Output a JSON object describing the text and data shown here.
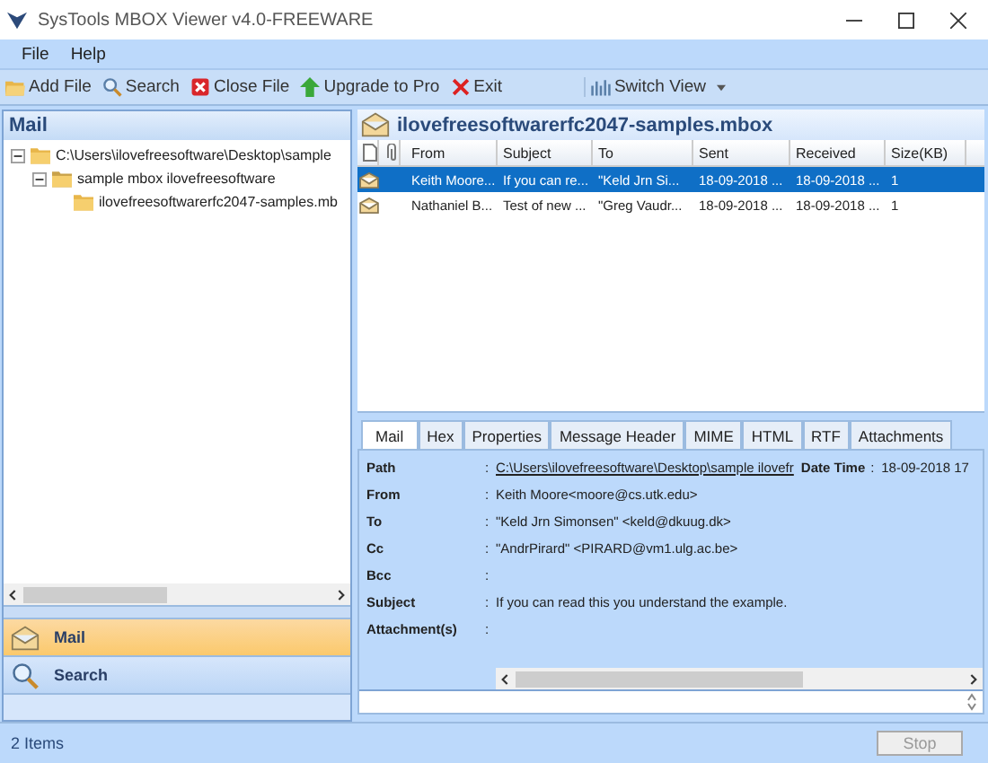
{
  "window": {
    "title": "SysTools MBOX Viewer v4.0-FREEWARE"
  },
  "menu": [
    "File",
    "Help"
  ],
  "toolbar": [
    {
      "kind": "add",
      "label": "Add File"
    },
    {
      "kind": "search",
      "label": "Search"
    },
    {
      "kind": "close",
      "label": "Close File"
    },
    {
      "kind": "upgrade",
      "label": "Upgrade to Pro"
    },
    {
      "kind": "exit",
      "label": "Exit"
    },
    {
      "kind": "switch",
      "label": "Switch View"
    }
  ],
  "sidebar": {
    "title": "Mail",
    "tree": [
      {
        "label": "C:\\Users\\ilovefreesoftware\\Desktop\\sample",
        "expanded": true,
        "children": [
          {
            "label": "sample mbox ilovefreesoftware",
            "expanded": true,
            "children": [
              {
                "label": "ilovefreesoftwarerfc2047-samples.mb"
              }
            ]
          }
        ]
      }
    ],
    "nav": [
      {
        "kind": "mail",
        "label": "Mail",
        "selected": true
      },
      {
        "kind": "search",
        "label": "Search",
        "selected": false
      }
    ]
  },
  "mailbox": {
    "title": "ilovefreesoftwarerfc2047-samples.mbox",
    "columns": [
      "From",
      "Subject",
      "To",
      "Sent",
      "Received",
      "Size(KB)"
    ],
    "rows": [
      {
        "selected": true,
        "cells": [
          "Keith Moore...",
          "If you can re...",
          "\"Keld Jrn Si...",
          "18-09-2018 ...",
          "18-09-2018 ...",
          "1"
        ]
      },
      {
        "selected": false,
        "cells": [
          "Nathaniel B...",
          "Test of new ...",
          "\"Greg Vaudr...",
          "18-09-2018 ...",
          "18-09-2018 ...",
          "1"
        ]
      }
    ]
  },
  "tabs": [
    {
      "label": "Mail",
      "selected": true
    },
    {
      "label": "Hex",
      "selected": false
    },
    {
      "label": "Properties",
      "selected": false
    },
    {
      "label": "Message Header",
      "selected": false
    },
    {
      "label": "MIME",
      "selected": false
    },
    {
      "label": "HTML",
      "selected": false
    },
    {
      "label": "RTF",
      "selected": false
    },
    {
      "label": "Attachments",
      "selected": false
    }
  ],
  "details": {
    "fields": [
      {
        "label": "Path",
        "value": "C:\\Users\\ilovefreesoftware\\Desktop\\sample ilovefr",
        "link": true
      },
      {
        "label": "From",
        "value": "Keith Moore<moore@cs.utk.edu>",
        "link": false
      },
      {
        "label": "To",
        "value": "\"Keld Jrn Simonsen\" <keld@dkuug.dk>",
        "link": false
      },
      {
        "label": "Cc",
        "value": "\"AndrPirard\" <PIRARD@vm1.ulg.ac.be>",
        "link": false
      },
      {
        "label": "Bcc"
      },
      {
        "label": "Subject",
        "value": "If you can read this you understand the example.",
        "link": false
      },
      {
        "label": "Attachment(s)"
      }
    ],
    "separator": ":",
    "date_time": {
      "label": "Date Time",
      "value": "18-09-2018 17"
    }
  },
  "status_bar": {
    "text": "2 Items",
    "stop": {
      "label": "Stop",
      "disabled": true
    }
  }
}
